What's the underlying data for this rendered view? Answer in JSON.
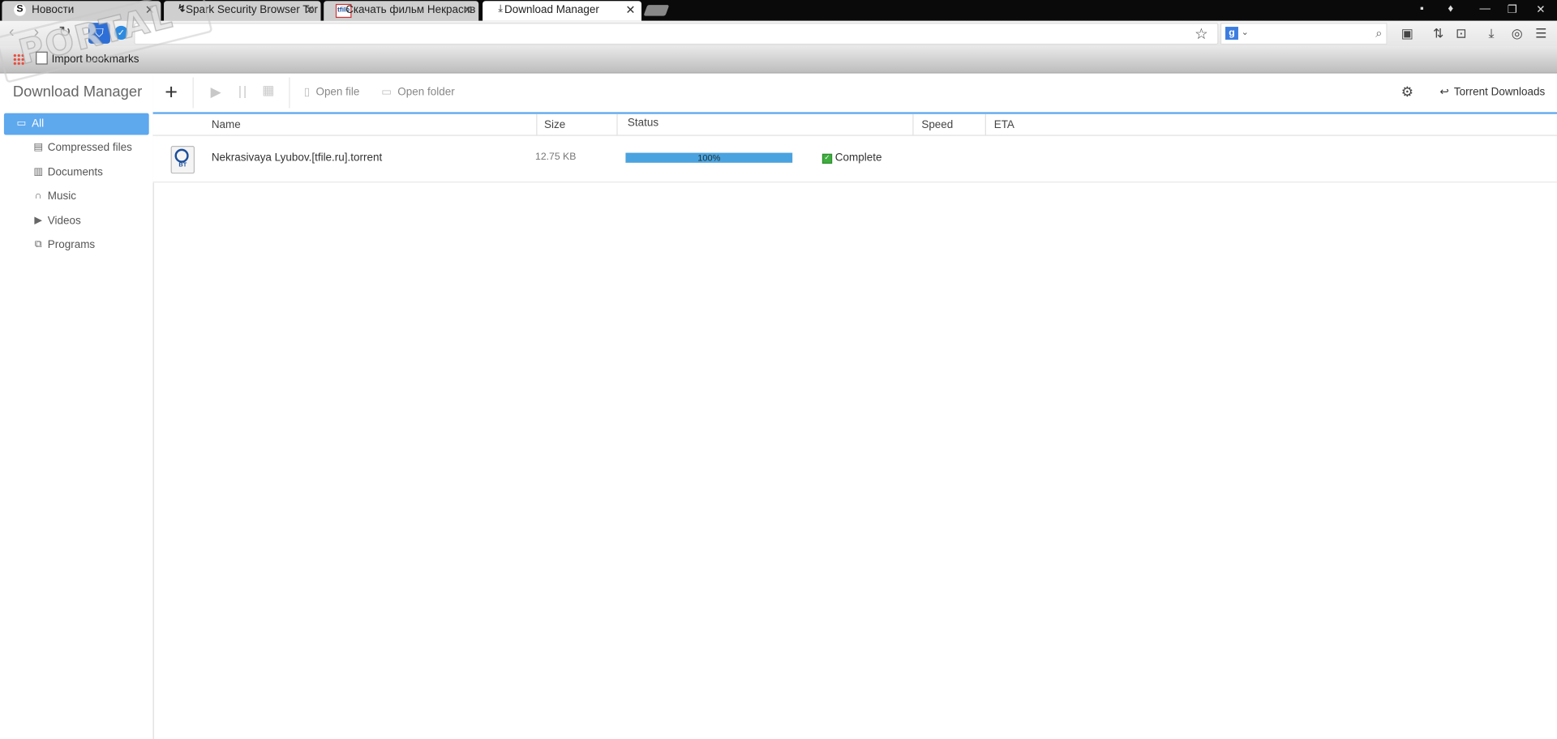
{
  "browser": {
    "tabs": [
      {
        "label": "Новости",
        "favicon": "S",
        "active": false
      },
      {
        "label": "Spark Security Browser Tor",
        "favicon": "↯",
        "active": false
      },
      {
        "label": "Скачать фильм Некрасив",
        "favicon": "tfile",
        "active": false
      },
      {
        "label": "Download Manager",
        "favicon": "download-icon",
        "active": true
      }
    ],
    "tab_close": "✕",
    "bookmarks": {
      "import_label": "Import bookmarks"
    },
    "search_engine_letter": "g"
  },
  "watermark": {
    "text": "PORTAL"
  },
  "download_manager": {
    "title": "Download Manager",
    "toolbar": {
      "open_file": "Open file",
      "open_folder": "Open folder",
      "torrent_downloads": "Torrent Downloads"
    },
    "sidebar": [
      {
        "label": "All",
        "icon": "folder-icon",
        "active": true
      },
      {
        "label": "Compressed files",
        "icon": "archive-icon",
        "active": false
      },
      {
        "label": "Documents",
        "icon": "document-icon",
        "active": false
      },
      {
        "label": "Music",
        "icon": "headphones-icon",
        "active": false
      },
      {
        "label": "Videos",
        "icon": "video-icon",
        "active": false
      },
      {
        "label": "Programs",
        "icon": "window-icon",
        "active": false
      }
    ],
    "columns": [
      "Name",
      "Size",
      "Status",
      "Speed",
      "ETA"
    ],
    "rows": [
      {
        "name": "Nekrasivaya Lyubov.[tfile.ru].torrent",
        "size": "12.75 KB",
        "progress": 1.0,
        "progress_text": "100%",
        "status": "Complete",
        "speed": "",
        "eta": ""
      }
    ]
  },
  "colors": {
    "accent": "#5ea8ee",
    "progress": "#4aa3df",
    "complete": "#3fae3f"
  }
}
